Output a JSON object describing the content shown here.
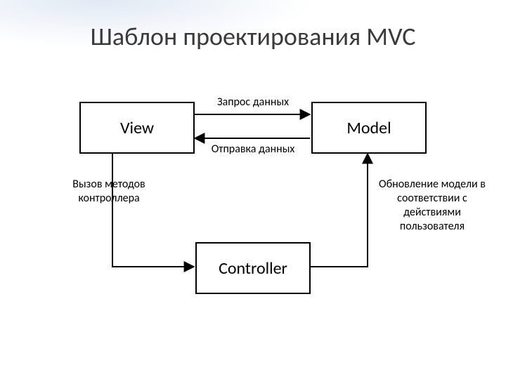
{
  "title": "Шаблон проектирования MVC",
  "nodes": {
    "view": "View",
    "model": "Model",
    "controller": "Controller"
  },
  "edges": {
    "view_to_model": "Запрос данных",
    "model_to_view": "Отправка данных",
    "view_to_controller": "Вызов методов контроллера",
    "controller_to_model": "Обновление модели в соответствии с действиями пользователя"
  }
}
